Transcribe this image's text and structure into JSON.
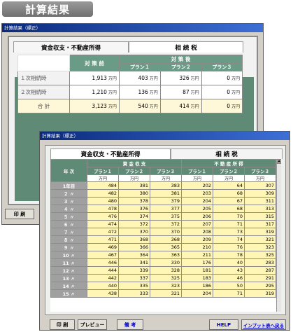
{
  "header": {
    "badge": "計算結果"
  },
  "window1": {
    "title": "計算結果（標正）",
    "tabs": [
      "資金収支・不動産所得",
      "相 続 税"
    ],
    "table": {
      "col_current": "対 策 前",
      "col_measures": "対   策   後",
      "plans": [
        "プラン１",
        "プラン２",
        "プラン３"
      ],
      "unit": "万円",
      "rows": [
        {
          "label": "１次相続時",
          "values": [
            "1,913",
            "403",
            "326",
            "0"
          ]
        },
        {
          "label": "２次相続時",
          "values": [
            "1,210",
            "136",
            "87",
            "0"
          ]
        },
        {
          "label": "合  計",
          "values": [
            "3,123",
            "540",
            "414",
            "0"
          ]
        }
      ]
    },
    "buttons": [
      "印 刷"
    ]
  },
  "window2": {
    "title": "計算結果（標正）",
    "tabs": [
      "資金収支・不動産所得",
      "相 続 税"
    ],
    "table": {
      "year_header": "年 次",
      "group1": "資 金 収 支",
      "group2": "不 動 産 所 得",
      "plans": [
        "プラン１",
        "プラン２",
        "プラン３",
        "プラン１",
        "プラン２",
        "プラン３"
      ],
      "unit": "万円",
      "rows": [
        {
          "label": "1年目",
          "values": [
            "484",
            "381",
            "383",
            "202",
            "64",
            "307"
          ]
        },
        {
          "label": "２ 〃",
          "values": [
            "482",
            "380",
            "381",
            "203",
            "68",
            "309"
          ]
        },
        {
          "label": "３ 〃",
          "values": [
            "480",
            "378",
            "379",
            "204",
            "67",
            "311"
          ]
        },
        {
          "label": "４ 〃",
          "values": [
            "478",
            "376",
            "377",
            "205",
            "68",
            "313"
          ]
        },
        {
          "label": "５ 〃",
          "values": [
            "476",
            "374",
            "375",
            "206",
            "70",
            "315"
          ]
        },
        {
          "label": "６ 〃",
          "values": [
            "474",
            "372",
            "372",
            "207",
            "71",
            "317"
          ]
        },
        {
          "label": "７ 〃",
          "values": [
            "472",
            "370",
            "370",
            "208",
            "73",
            "319"
          ]
        },
        {
          "label": "８ 〃",
          "values": [
            "471",
            "368",
            "368",
            "209",
            "74",
            "321"
          ]
        },
        {
          "label": "９ 〃",
          "values": [
            "469",
            "366",
            "365",
            "210",
            "76",
            "323"
          ]
        },
        {
          "label": "10 〃",
          "values": [
            "467",
            "364",
            "363",
            "211",
            "78",
            "325"
          ]
        },
        {
          "label": "11 〃",
          "values": [
            "446",
            "341",
            "330",
            "176",
            "40",
            "283"
          ]
        },
        {
          "label": "12 〃",
          "values": [
            "444",
            "339",
            "328",
            "181",
            "43",
            "287"
          ]
        },
        {
          "label": "13 〃",
          "values": [
            "442",
            "337",
            "325",
            "183",
            "46",
            "291"
          ]
        },
        {
          "label": "14 〃",
          "values": [
            "440",
            "335",
            "323",
            "186",
            "50",
            "295"
          ]
        },
        {
          "label": "15 〃",
          "values": [
            "438",
            "333",
            "321",
            "204",
            "71",
            "319"
          ]
        }
      ]
    },
    "buttons": {
      "print": "印 刷",
      "preview": "プレビュー",
      "note": "備 考",
      "help": "HELP",
      "back": "インプット表へ戻る"
    }
  },
  "colors": {
    "accent_green": "#5e8a76",
    "title_blue": "#0a2a7c",
    "cell_yellow": "#fff5b5",
    "link_blue": "#0000cc"
  }
}
